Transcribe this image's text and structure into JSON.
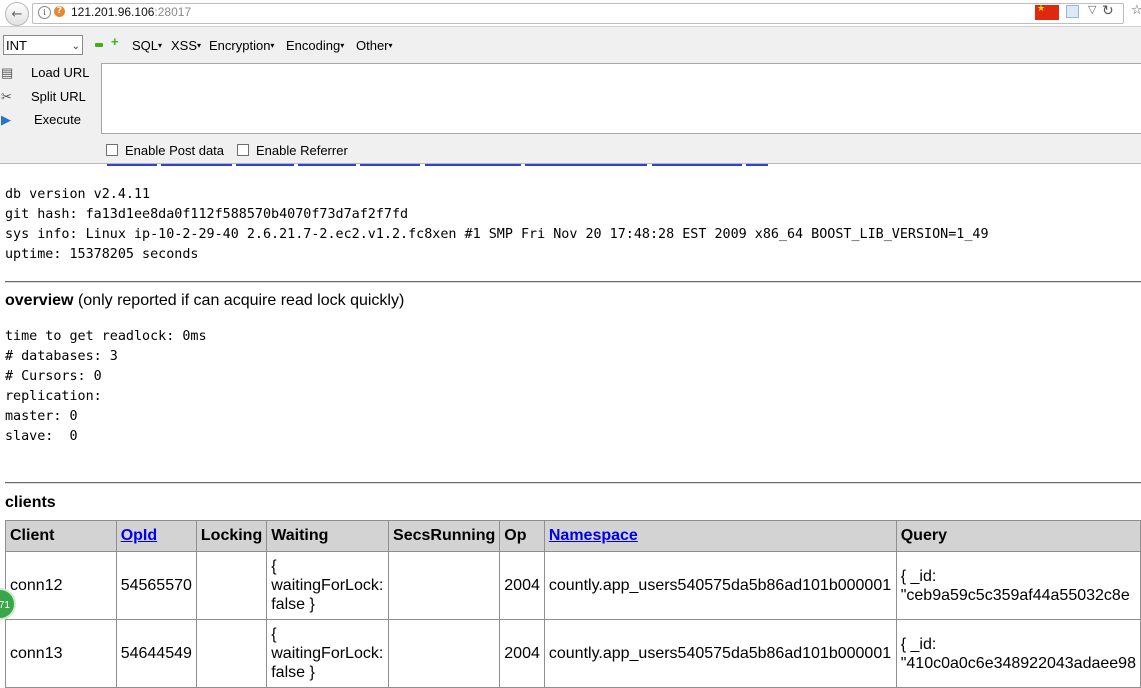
{
  "browser": {
    "url_host": "121.201.96.106",
    "url_port": ":28017"
  },
  "hackbar": {
    "type_select": "INT",
    "menus": [
      "SQL",
      "XSS",
      "Encryption",
      "Encoding",
      "Other"
    ],
    "side_buttons": [
      "Load URL",
      "Split URL",
      "Execute"
    ],
    "checkboxes": [
      "Enable Post data",
      "Enable Referrer"
    ]
  },
  "server_info": {
    "lines": [
      "db version v2.4.11",
      "git hash: fa13d1ee8da0f112f588570b4070f73d7af2f7fd",
      "sys info: Linux ip-10-2-29-40 2.6.21.7-2.ec2.v1.2.fc8xen #1 SMP Fri Nov 20 17:48:28 EST 2009 x86_64 BOOST_LIB_VERSION=1_49",
      "uptime: 15378205 seconds"
    ]
  },
  "overview": {
    "title": "overview",
    "subtitle": "(only reported if can acquire read lock quickly)",
    "lines": [
      "time to get readlock: 0ms",
      "# databases: 3",
      "# Cursors: 0",
      "replication:",
      "master: 0",
      "slave:  0"
    ]
  },
  "clients": {
    "title": "clients",
    "columns": [
      "Client",
      "OpId",
      "Locking",
      "Waiting",
      "SecsRunning",
      "Op",
      "Namespace",
      "Query"
    ],
    "rows": [
      {
        "client": "conn12",
        "opid": "54565570",
        "locking": "",
        "waiting_1": "{",
        "waiting_2": "waitingForLock:",
        "waiting_3": "false }",
        "secs": "",
        "op": "2004",
        "namespace": "countly.app_users540575da5b86ad101b000001",
        "query_1": "{ _id:",
        "query_2": "\"ceb9a59c5c359af44a55032c8e"
      },
      {
        "client": "conn13",
        "opid": "54644549",
        "locking": "",
        "waiting_1": "{",
        "waiting_2": "waitingForLock:",
        "waiting_3": "false }",
        "secs": "",
        "op": "2004",
        "namespace": "countly.app_users540575da5b86ad101b000001",
        "query_1": "{ _id:",
        "query_2": "\"410c0a0c6e348922043adaee98"
      }
    ]
  },
  "badge": "71"
}
